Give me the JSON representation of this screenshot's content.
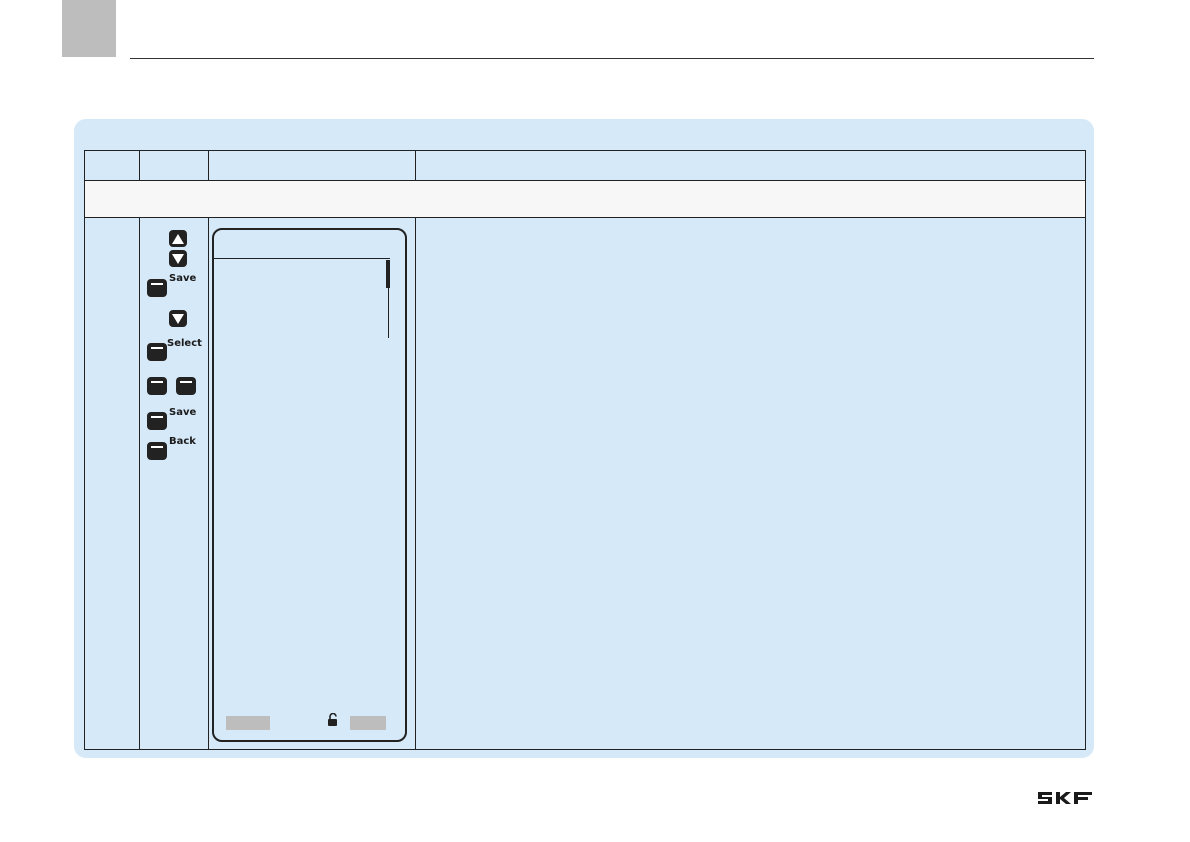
{
  "page": {
    "brand": "SKF",
    "colors": {
      "panel": "#d6e9f8",
      "tab": "#bdbdbd",
      "section_row": "#f7f7f7",
      "ink": "#222222"
    }
  },
  "keys": {
    "up_arrow": "up-arrow-icon",
    "down_arrow": "down-arrow-icon",
    "save_label_1": "Save",
    "select_label": "Select",
    "save_label_2": "Save",
    "back_label": "Back"
  },
  "display": {
    "lock_state": "unlocked-lock-icon"
  }
}
